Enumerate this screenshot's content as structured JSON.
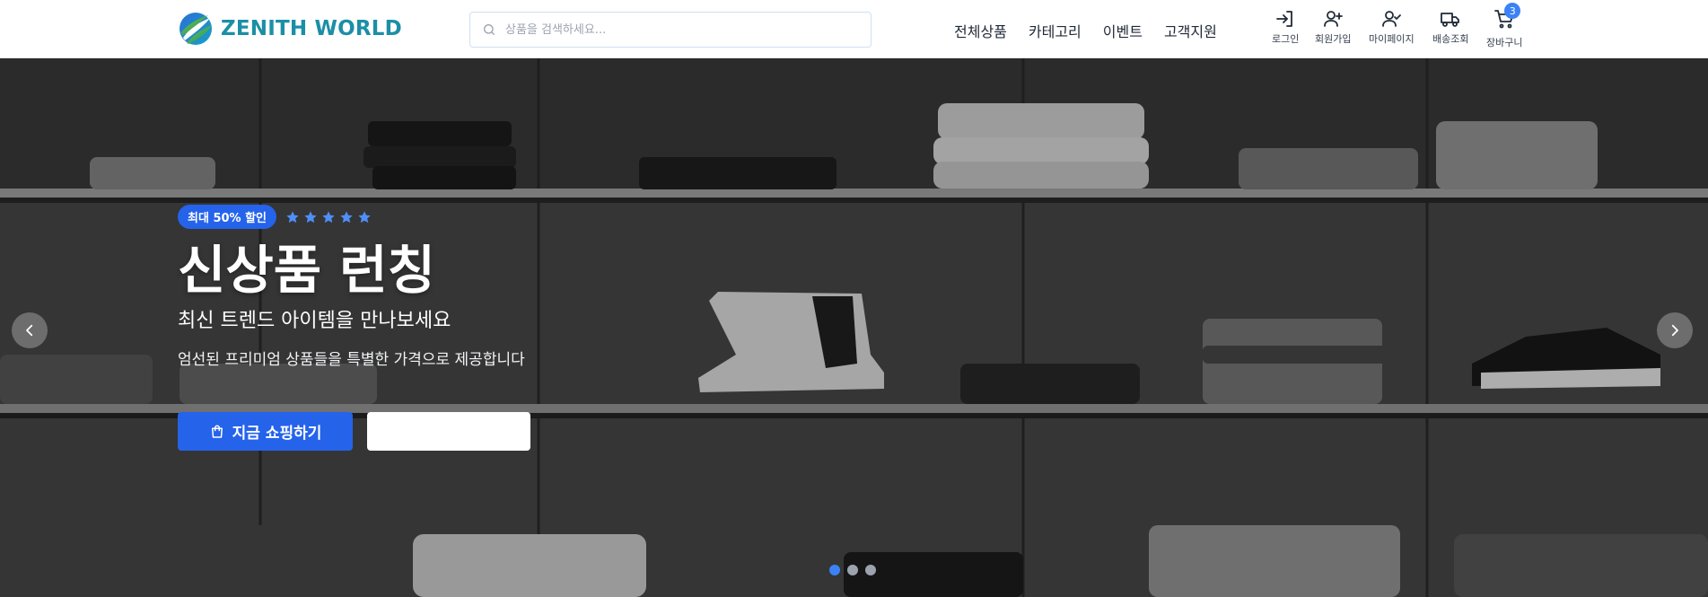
{
  "brand": {
    "name": "ZENITH WORLD",
    "logo_icon": "globe-swirl-logo",
    "colors": {
      "teal": "#1b8fa6",
      "green": "#2aa15a",
      "blue": "#2563eb"
    }
  },
  "search": {
    "placeholder": "상품을 검색하세요...",
    "value": "",
    "icon": "search-icon"
  },
  "nav": {
    "items": [
      {
        "label": "전체상품"
      },
      {
        "label": "카테고리"
      },
      {
        "label": "이벤트"
      },
      {
        "label": "고객지원"
      }
    ]
  },
  "utility": {
    "login": {
      "label": "로그인",
      "icon": "login-icon"
    },
    "signup": {
      "label": "회원가입",
      "icon": "user-plus-icon"
    },
    "mypage": {
      "label": "마이페이지",
      "icon": "user-check-icon"
    },
    "delivery": {
      "label": "배송조회",
      "icon": "truck-icon"
    },
    "cart": {
      "label": "장바구니",
      "icon": "cart-icon",
      "count": "3"
    }
  },
  "hero": {
    "badge": "최대 50% 할인",
    "rating_stars": 5,
    "title": "신상품 런칭",
    "subtitle": "최신 트렌드 아이템을 만나보세요",
    "description": "엄선된 프리미엄 상품들을 특별한 가격으로 제공합니다",
    "primary_button": "지금 쇼핑하기",
    "secondary_button": "",
    "slides_total": 3,
    "active_slide": 1,
    "accent_color": "#2563eb",
    "star_color": "#4f8ff7"
  }
}
